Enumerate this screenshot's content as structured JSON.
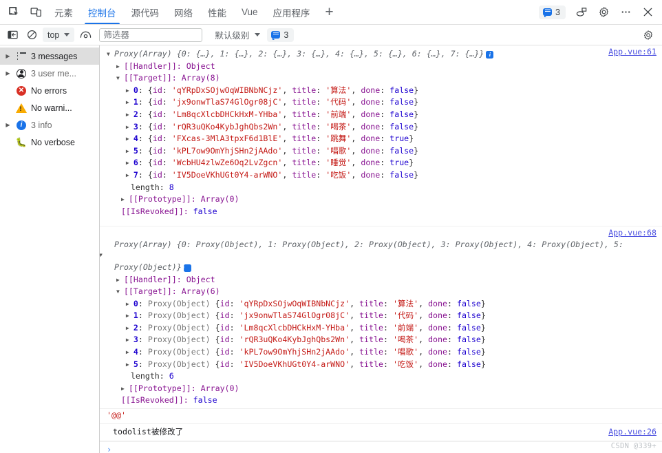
{
  "tabbar": {
    "inspect_icon": "inspect-element-icon",
    "device_icon": "device-toolbar-icon",
    "tabs": [
      {
        "label": "元素",
        "active": false
      },
      {
        "label": "控制台",
        "active": true
      },
      {
        "label": "源代码",
        "active": false
      },
      {
        "label": "网络",
        "active": false
      },
      {
        "label": "性能",
        "active": false
      },
      {
        "label": "Vue",
        "active": false
      },
      {
        "label": "应用程序",
        "active": false
      }
    ],
    "add_tab_label": "+",
    "message_count": "3",
    "right_icons": [
      "message-bubble-icon",
      "cast-icon",
      "settings-gear-icon",
      "more-options-icon",
      "close-icon"
    ]
  },
  "filterbar": {
    "sidebar_toggle_icon": "show-console-sidebar-icon",
    "clear_icon": "clear-console-icon",
    "context_selector": "top",
    "eye_icon": "live-expression-icon",
    "filter_placeholder": "筛选器",
    "filter_value": "",
    "level_selector": "默认级别",
    "message_count": "3",
    "settings_icon": "console-settings-icon"
  },
  "sidebar": {
    "items": [
      {
        "label": "3 messages",
        "icon": "list-icon",
        "arrow": true,
        "selected": true,
        "dim": false
      },
      {
        "label": "3 user me...",
        "icon": "user-message-icon",
        "arrow": true,
        "selected": false,
        "dim": true
      },
      {
        "label": "No errors",
        "icon": "error-icon",
        "arrow": false,
        "selected": false,
        "dim": false
      },
      {
        "label": "No warni...",
        "icon": "warning-icon",
        "arrow": false,
        "selected": false,
        "dim": false
      },
      {
        "label": "3 info",
        "icon": "info-icon",
        "arrow": true,
        "selected": false,
        "dim": true
      },
      {
        "label": "No verbose",
        "icon": "verbose-bug-icon",
        "arrow": false,
        "selected": false,
        "dim": false
      }
    ]
  },
  "console": {
    "entry1": {
      "source": "App.vue:61",
      "header": "Proxy(Array) {0: {…}, 1: {…}, 2: {…}, 3: {…}, 4: {…}, 5: {…}, 6: {…}, 7: {…}}",
      "handler": "[[Handler]]: Object",
      "target": "[[Target]]: Array(8)",
      "items": [
        {
          "index": "0",
          "id": "qYRpDxSOjwOqWIBNbNCjz",
          "title": "算法",
          "done": "false"
        },
        {
          "index": "1",
          "id": "jx9onwTlaS74GlOgr08jC",
          "title": "代码",
          "done": "false"
        },
        {
          "index": "2",
          "id": "Lm8qcXlcbDHCkHxM-YHba",
          "title": "前端",
          "done": "false"
        },
        {
          "index": "3",
          "id": "rQR3uQKo4KybJghQbs2Wn",
          "title": "喝茶",
          "done": "false"
        },
        {
          "index": "4",
          "id": "FXcas-3MlA3tpxF6d1BlE",
          "title": "跳舞",
          "done": "true"
        },
        {
          "index": "5",
          "id": "kPL7ow9OmYhjSHn2jAAdo",
          "title": "唱歌",
          "done": "false"
        },
        {
          "index": "6",
          "id": "WcbHU4zlwZe6Oq2LvZgcn",
          "title": "睡觉",
          "done": "true"
        },
        {
          "index": "7",
          "id": "IV5DoeVKhUGt0Y4-arWNO",
          "title": "吃饭",
          "done": "false"
        }
      ],
      "length_label": "length:",
      "length_value": "8",
      "prototype": "[[Prototype]]: Array(0)",
      "isrevoked_key": "[[IsRevoked]]:",
      "isrevoked_value": "false"
    },
    "entry2": {
      "source": "App.vue:68",
      "header_line1": "Proxy(Array) {0: Proxy(Object), 1: Proxy(Object), 2: Proxy(Object), 3: Proxy(Object), 4: Proxy(Obj",
      "header_line2": "ect), 5: Proxy(Object)}",
      "handler": "[[Handler]]: Object",
      "target": "[[Target]]: Array(6)",
      "items": [
        {
          "index": "0",
          "wrapper": "Proxy(Object)",
          "id": "qYRpDxSOjwOqWIBNbNCjz",
          "title": "算法",
          "done": "false"
        },
        {
          "index": "1",
          "wrapper": "Proxy(Object)",
          "id": "jx9onwTlaS74GlOgr08jC",
          "title": "代码",
          "done": "false"
        },
        {
          "index": "2",
          "wrapper": "Proxy(Object)",
          "id": "Lm8qcXlcbDHCkHxM-YHba",
          "title": "前端",
          "done": "false"
        },
        {
          "index": "3",
          "wrapper": "Proxy(Object)",
          "id": "rQR3uQKo4KybJghQbs2Wn",
          "title": "喝茶",
          "done": "false"
        },
        {
          "index": "4",
          "wrapper": "Proxy(Object)",
          "id": "kPL7ow9OmYhjSHn2jAAdo",
          "title": "唱歌",
          "done": "false"
        },
        {
          "index": "5",
          "wrapper": "Proxy(Object)",
          "id": "IV5DoeVKhUGt0Y4-arWNO",
          "title": "吃饭",
          "done": "false"
        }
      ],
      "length_label": "length:",
      "length_value": "6",
      "prototype": "[[Prototype]]: Array(0)",
      "isrevoked_key": "[[IsRevoked]]:",
      "isrevoked_value": "false"
    },
    "entry3": {
      "text": "'@@'"
    },
    "entry4": {
      "text": "todolist被修改了",
      "source": "App.vue:26"
    },
    "prompt_caret": "›",
    "watermark": "CSDN @339+"
  },
  "colors": {
    "accent": "#1a73e8",
    "error": "#d93025",
    "warning": "#f9ab00",
    "string": "#c41a16",
    "number": "#1c00cf",
    "key": "#881391",
    "link": "#4a4fe0"
  }
}
